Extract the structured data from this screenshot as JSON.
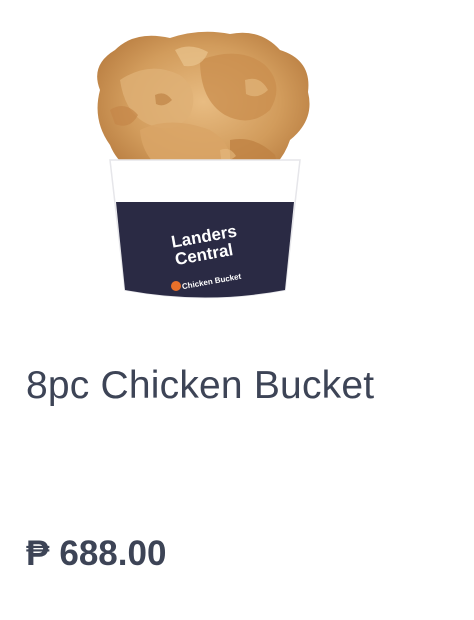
{
  "product": {
    "name": "8pc Chicken Bucket",
    "currency_symbol": "₱",
    "price": "688.00",
    "image": {
      "bucket_brand_line1": "Landers",
      "bucket_brand_line2": "Central",
      "bucket_tagline": "Chicken Bucket"
    }
  },
  "colors": {
    "text": "#3d4456",
    "bucket_band": "#2a2a44",
    "chicken": "#d2a064",
    "logo_accent": "#e8702a"
  }
}
